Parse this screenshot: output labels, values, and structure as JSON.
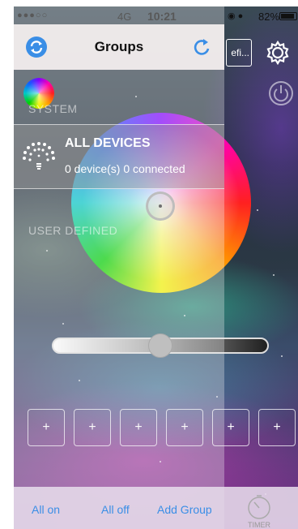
{
  "status_bar": {
    "signal": "●●●○○",
    "network": "4G",
    "time": "10:21",
    "battery_percent": "82%"
  },
  "header": {
    "title": "Groups"
  },
  "sections": {
    "system": "SYSTEM",
    "user_defined": "USER DEFINED"
  },
  "device": {
    "name": "ALL DEVICES",
    "info": "0 device(s) 0 connected"
  },
  "behind": {
    "define_button": "efi..."
  },
  "slider": {
    "level": 0.5
  },
  "add_buttons": [
    "+",
    "+",
    "+",
    "+",
    "+",
    "+"
  ],
  "toolbar": {
    "all_on": "All on",
    "all_off": "All off",
    "add_group": "Add Group",
    "timer": "TIMER"
  },
  "colors": {
    "accent": "#3a8ee6"
  },
  "icons": [
    "sync-icon",
    "refresh-icon",
    "gear-icon",
    "power-icon",
    "bulb-icon",
    "timer-icon",
    "color-wheel"
  ]
}
